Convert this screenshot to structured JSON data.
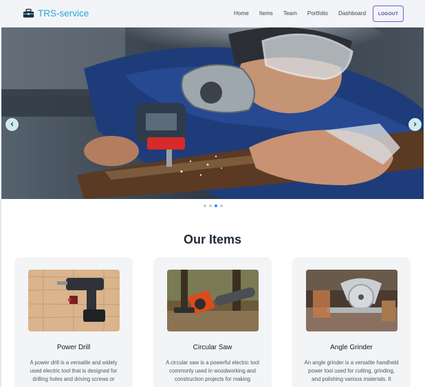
{
  "header": {
    "brand": "TRS-service",
    "brand_icon": "toolbox-icon",
    "nav": [
      "Home",
      "Items",
      "Team",
      "Portfolio",
      "Dashboard"
    ],
    "logout_label": "LOGOUT"
  },
  "carousel": {
    "prev_icon": "chevron-left-icon",
    "next_icon": "chevron-right-icon",
    "slide_count": 4,
    "active_index": 2
  },
  "section": {
    "title": "Our Items"
  },
  "items": [
    {
      "title": "Power Drill",
      "desc": "A power drill is a versatile and widely used electric tool that is designed for drilling holes and driving screws or"
    },
    {
      "title": "Circular Saw",
      "desc": "A circular saw is a powerful electric tool commonly used in woodworking and construction projects for making"
    },
    {
      "title": "Angle Grinder",
      "desc": "An angle grinder is a versatile handheld power tool used for cutting, grinding, and polishing various materials. It"
    }
  ],
  "colors": {
    "brand": "#2aa7d6",
    "logout_border": "#6d5bd0",
    "active_dot": "#3b82f6"
  }
}
